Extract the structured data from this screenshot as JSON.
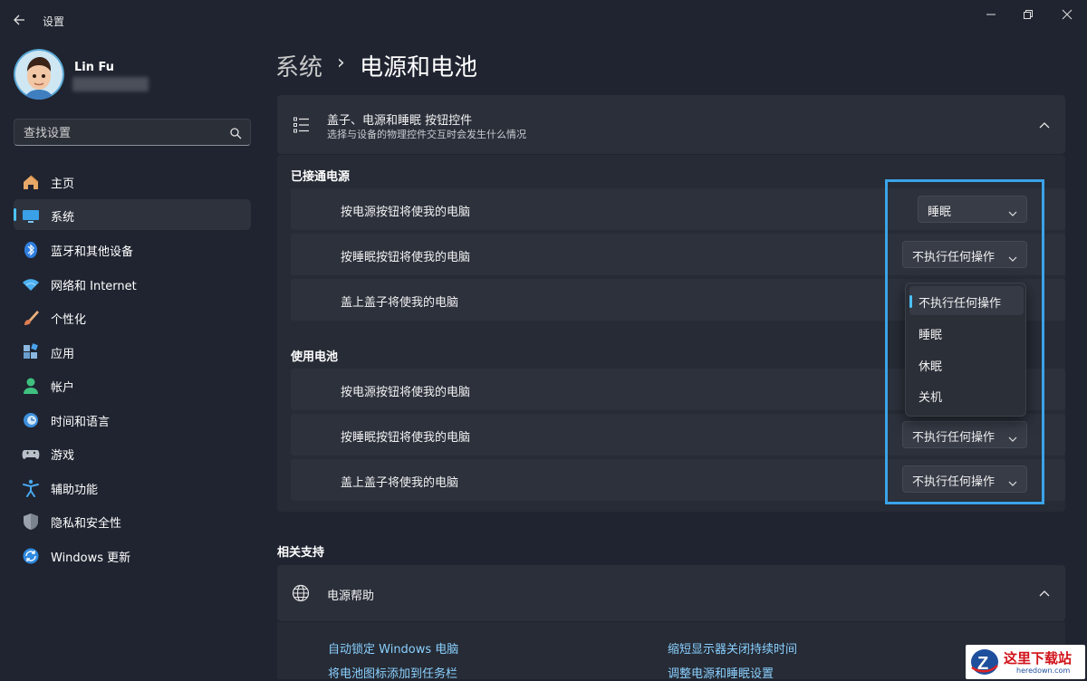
{
  "window": {
    "app_title": "设置",
    "back_icon": "back-arrow-icon",
    "controls": [
      "minimize-icon",
      "restore-icon",
      "close-icon"
    ]
  },
  "user": {
    "name": "Lin Fu"
  },
  "search": {
    "placeholder": "查找设置"
  },
  "sidebar": {
    "items": [
      {
        "label": "主页",
        "icon": "home-icon"
      },
      {
        "label": "系统",
        "icon": "system-icon",
        "selected": true
      },
      {
        "label": "蓝牙和其他设备",
        "icon": "bluetooth-icon"
      },
      {
        "label": "网络和 Internet",
        "icon": "wifi-icon"
      },
      {
        "label": "个性化",
        "icon": "brush-icon"
      },
      {
        "label": "应用",
        "icon": "apps-icon"
      },
      {
        "label": "帐户",
        "icon": "account-icon"
      },
      {
        "label": "时间和语言",
        "icon": "clock-globe-icon"
      },
      {
        "label": "游戏",
        "icon": "gamepad-icon"
      },
      {
        "label": "辅助功能",
        "icon": "accessibility-icon"
      },
      {
        "label": "隐私和安全性",
        "icon": "shield-icon"
      },
      {
        "label": "Windows 更新",
        "icon": "update-icon"
      }
    ]
  },
  "breadcrumb": {
    "parent": "系统",
    "separator": "›",
    "current": "电源和电池"
  },
  "controls_card": {
    "title": "盖子、电源和睡眠 按钮控件",
    "subtitle": "选择与设备的物理控件交互时会发生什么情况",
    "plugged_in": {
      "heading": "已接通电源",
      "rows": [
        {
          "label": "按电源按钮将使我的电脑",
          "value": "睡眠"
        },
        {
          "label": "按睡眠按钮将使我的电脑",
          "value": "不执行任何操作"
        },
        {
          "label": "盖上盖子将使我的电脑",
          "value": ""
        }
      ]
    },
    "on_battery": {
      "heading": "使用电池",
      "rows": [
        {
          "label": "按电源按钮将使我的电脑",
          "value": ""
        },
        {
          "label": "按睡眠按钮将使我的电脑",
          "value": "不执行任何操作"
        },
        {
          "label": "盖上盖子将使我的电脑",
          "value": "不执行任何操作"
        }
      ]
    },
    "dropdown_open": {
      "options": [
        "不执行任何操作",
        "睡眠",
        "休眠",
        "关机"
      ],
      "selected_index": 0
    }
  },
  "related": {
    "heading": "相关支持",
    "help_title": "电源帮助",
    "links": [
      "自动锁定 Windows 电脑",
      "缩短显示器关闭持续时间",
      "将电池图标添加到任务栏",
      "调整电源和睡眠设置"
    ]
  },
  "watermark": {
    "text": "这里下载站",
    "sub": "heredown.com"
  },
  "colors": {
    "accent": "#4cc2ff",
    "link": "#8ad0ff",
    "highlight_box": "#3ba3e8",
    "background": "#1f2430"
  }
}
